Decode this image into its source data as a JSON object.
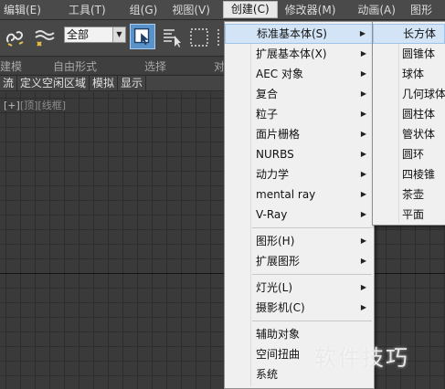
{
  "menubar": {
    "items": [
      "编辑(E)",
      "工具(T)",
      "组(G)",
      "视图(V)",
      "创建(C)",
      "修改器(M)",
      "动画(A)",
      "图形"
    ]
  },
  "toolbar": {
    "selection_filter": "全部"
  },
  "ribbon": {
    "labels": [
      "建模",
      "自由形式",
      "选择",
      "对"
    ]
  },
  "tabs": [
    "流",
    "定义空闲区域",
    "模拟",
    "显示"
  ],
  "viewport": {
    "label_plus": "[+]",
    "label_view": "[顶]",
    "label_mode": "[线框]"
  },
  "create_menu": {
    "items": [
      {
        "label": "标准基本体(S)",
        "submenu": true
      },
      {
        "label": "扩展基本体(X)",
        "submenu": true
      },
      {
        "label": "AEC 对象",
        "submenu": true
      },
      {
        "label": "复合",
        "submenu": true
      },
      {
        "label": "粒子",
        "submenu": true
      },
      {
        "label": "面片栅格",
        "submenu": true
      },
      {
        "label": "NURBS",
        "submenu": true
      },
      {
        "label": "动力学",
        "submenu": true
      },
      {
        "label": "mental ray",
        "submenu": true
      },
      {
        "label": "V-Ray",
        "submenu": true
      },
      {
        "label": "图形(H)",
        "submenu": true
      },
      {
        "label": "扩展图形",
        "submenu": true
      },
      {
        "label": "灯光(L)",
        "submenu": true
      },
      {
        "label": "摄影机(C)",
        "submenu": true
      },
      {
        "label": "辅助对象",
        "submenu": false
      },
      {
        "label": "空间扭曲",
        "submenu": false
      },
      {
        "label": "系统",
        "submenu": false
      }
    ]
  },
  "standard_primitives_menu": {
    "items": [
      "长方体",
      "圆锥体",
      "球体",
      "几何球体",
      "圆柱体",
      "管状体",
      "圆环",
      "四棱锥",
      "茶壶",
      "平面"
    ]
  },
  "watermark": "软件技巧",
  "colors": {
    "menubar_bg": "#4a4a4a",
    "viewport_bg": "#3a3a3a",
    "menu_bg": "#f0f0f0",
    "highlight": "#d2e4f6",
    "select_button": "#5a93c9"
  }
}
